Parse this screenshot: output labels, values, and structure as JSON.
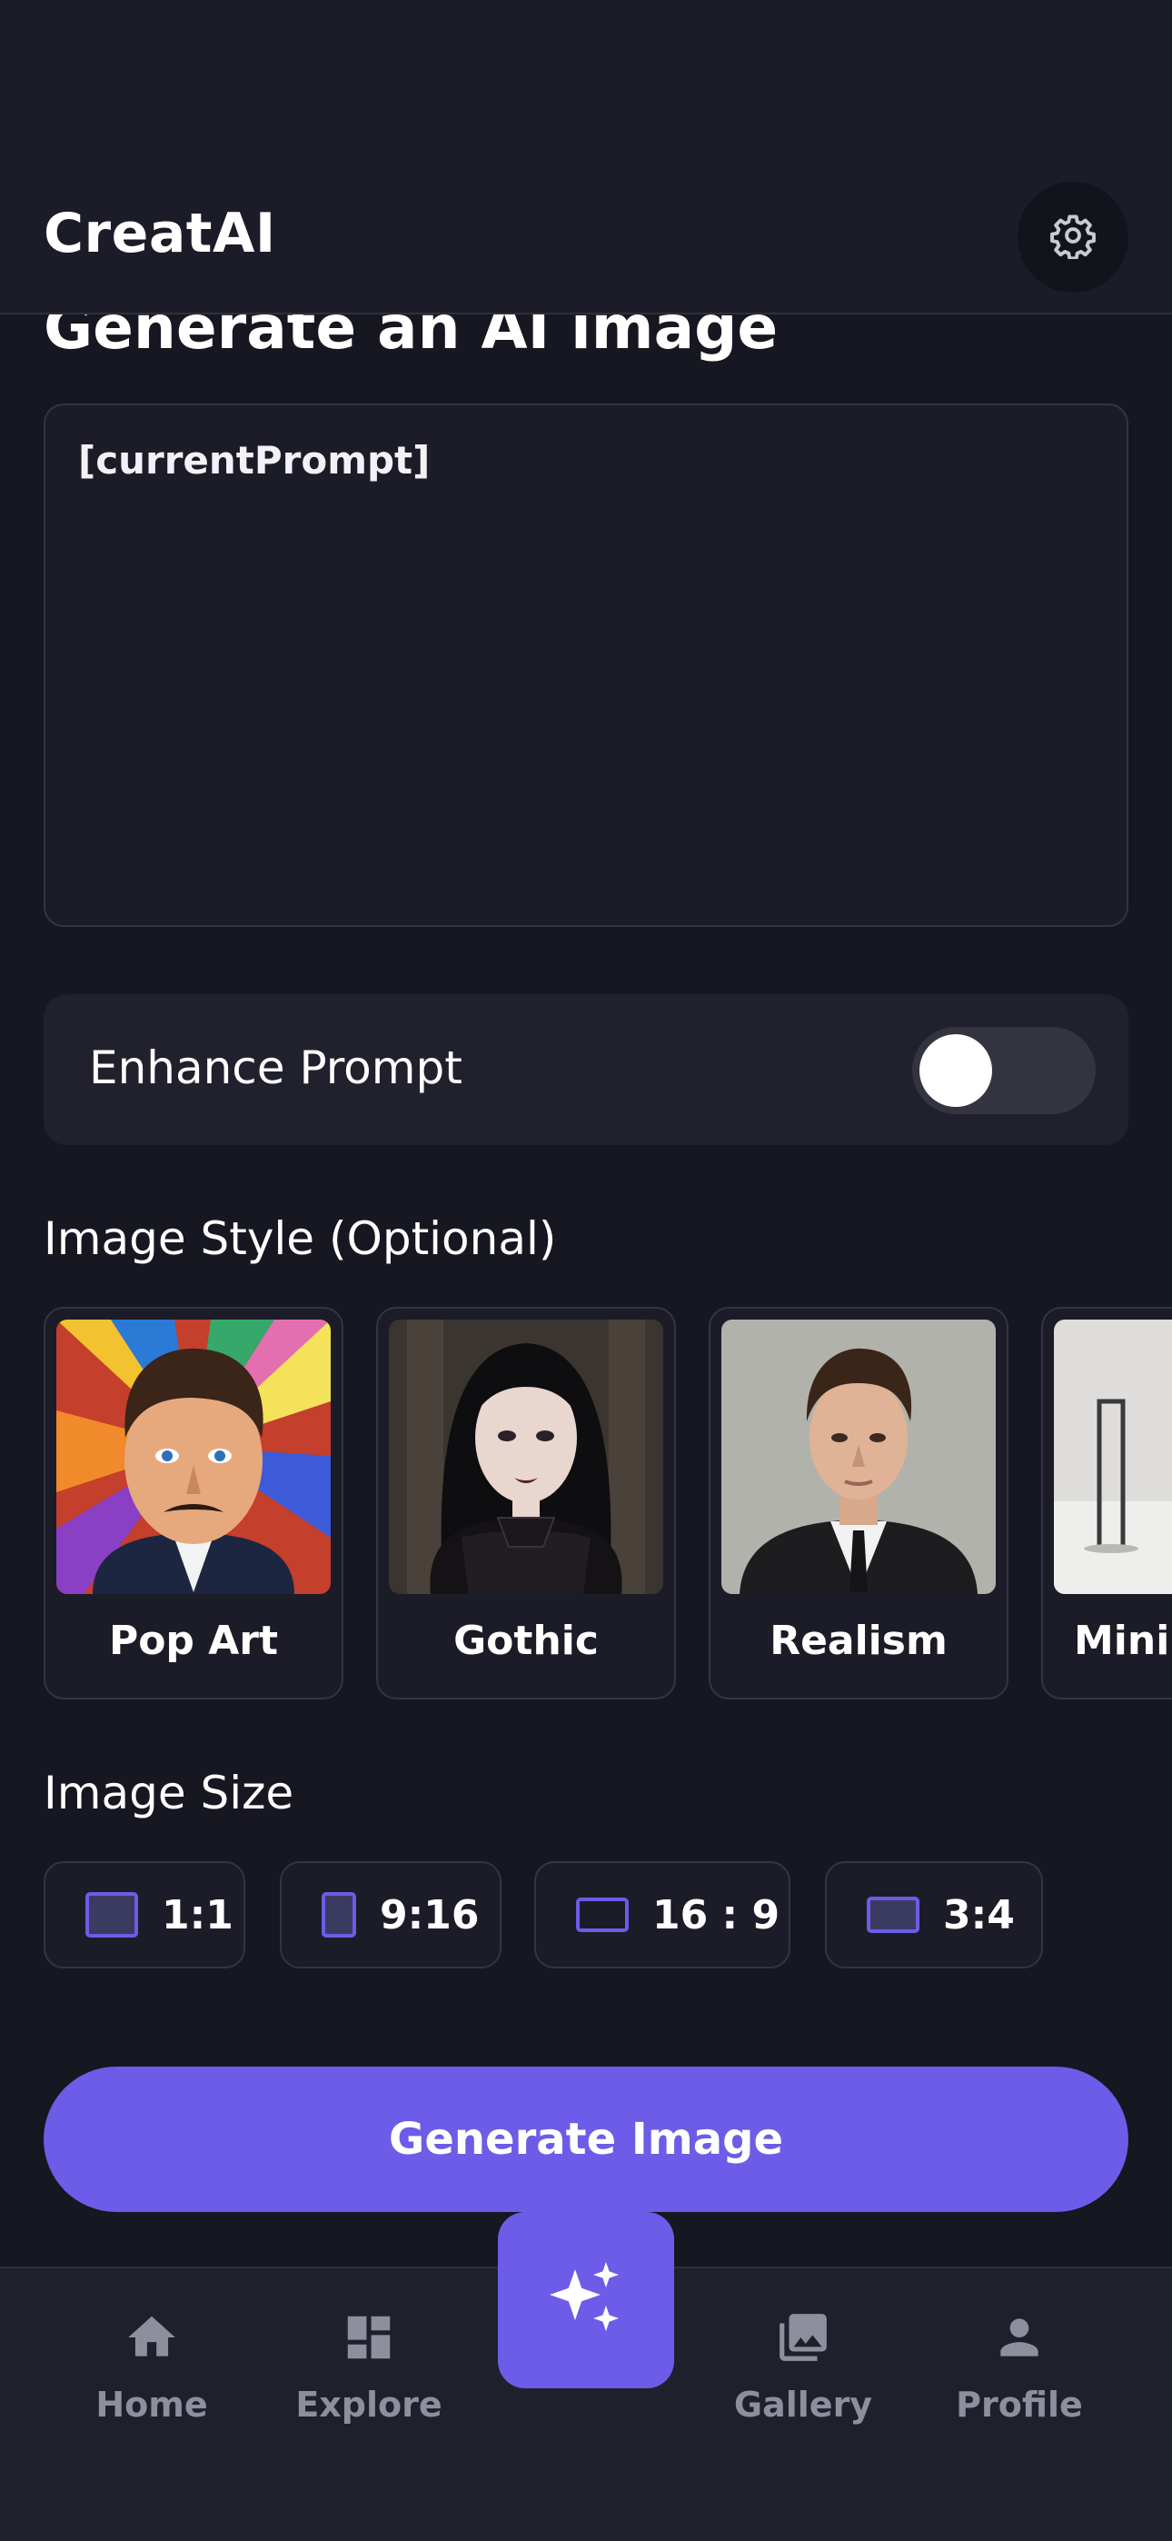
{
  "header": {
    "title": "CreatAI",
    "settings_icon": "gear-icon"
  },
  "main": {
    "heading": "Generate an AI image",
    "prompt": {
      "value": "[currentPrompt]"
    },
    "enhance": {
      "label": "Enhance Prompt",
      "enabled": false
    },
    "style_label": "Image Style (Optional)",
    "styles": [
      {
        "name": "Pop Art"
      },
      {
        "name": "Gothic"
      },
      {
        "name": "Realism"
      },
      {
        "name": "Minimalism"
      }
    ],
    "size_label": "Image Size",
    "sizes": [
      {
        "label": "1:1"
      },
      {
        "label": "9:16"
      },
      {
        "label": "16 : 9"
      },
      {
        "label": "3:4"
      }
    ],
    "generate_label": "Generate Image"
  },
  "nav": {
    "items": [
      {
        "label": "Home",
        "icon": "home-icon"
      },
      {
        "label": "Explore",
        "icon": "dashboard-icon"
      },
      {
        "label": "Gallery",
        "icon": "gallery-icon"
      },
      {
        "label": "Profile",
        "icon": "person-icon"
      }
    ],
    "center_icon": "sparkle-icon"
  },
  "colors": {
    "accent": "#6c5ce7",
    "background": "#161720",
    "surface": "#1b1c27"
  }
}
